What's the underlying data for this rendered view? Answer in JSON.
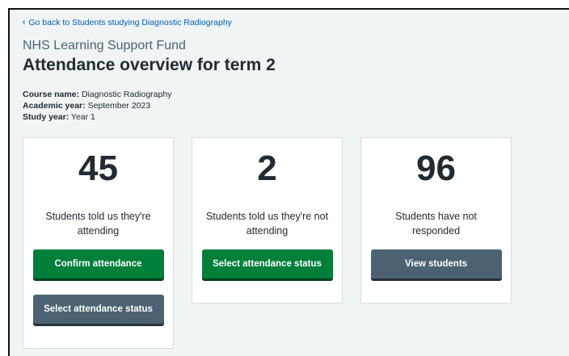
{
  "back_link": {
    "label": "Go back to Students studying Diagnostic Radiography"
  },
  "header": {
    "caption": "NHS Learning Support Fund",
    "title": "Attendance overview for term 2"
  },
  "details": {
    "course_label": "Course name:",
    "course_value": "Diagnostic Radiography",
    "year_label": "Academic year:",
    "year_value": "September 2023",
    "study_label": "Study year:",
    "study_value": "Year 1"
  },
  "cards": [
    {
      "count": "45",
      "description": "Students told us they're attending",
      "buttons": [
        {
          "label": "Confirm attendance",
          "style": "green"
        },
        {
          "label": "Select attendance status",
          "style": "grey"
        }
      ]
    },
    {
      "count": "2",
      "description": "Students told us they're not attending",
      "buttons": [
        {
          "label": "Select attendance status",
          "style": "green"
        }
      ]
    },
    {
      "count": "96",
      "description": "Students have not responded",
      "buttons": [
        {
          "label": "View students",
          "style": "grey"
        }
      ]
    }
  ],
  "colors": {
    "link": "#005eb8",
    "primary": "#007f3b",
    "secondary": "#4c6272",
    "background": "#f0f4f5"
  }
}
